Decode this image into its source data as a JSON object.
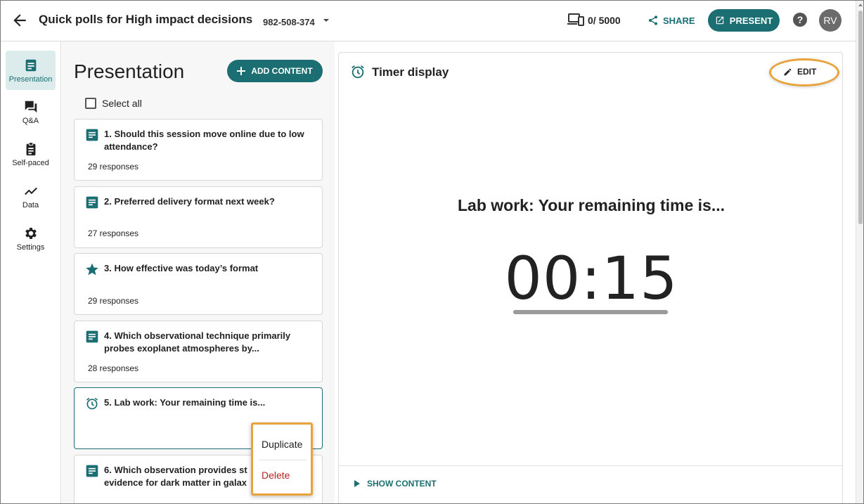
{
  "header": {
    "title": "Quick polls for High impact decisions",
    "session_code": "982-508-374",
    "participants": "0/ 5000",
    "share_label": "SHARE",
    "present_label": "PRESENT",
    "help_label": "?",
    "avatar_initials": "RV"
  },
  "sidebar": {
    "items": [
      {
        "label": "Presentation",
        "icon": "document-icon",
        "active": true
      },
      {
        "label": "Q&A",
        "icon": "chat-icon",
        "active": false
      },
      {
        "label": "Self-paced",
        "icon": "clipboard-icon",
        "active": false
      },
      {
        "label": "Data",
        "icon": "trend-icon",
        "active": false
      },
      {
        "label": "Settings",
        "icon": "gear-icon",
        "active": false
      }
    ]
  },
  "content_list": {
    "heading": "Presentation",
    "add_label": "ADD CONTENT",
    "select_all_label": "Select all",
    "items": [
      {
        "title": "1. Should this session move online due to low attendance?",
        "responses": "29 responses",
        "icon": "poll-icon"
      },
      {
        "title": "2. Preferred delivery format next week?",
        "responses": "27 responses",
        "icon": "poll-icon"
      },
      {
        "title": "3. How effective was today’s format",
        "responses": "29 responses",
        "icon": "star-icon"
      },
      {
        "title": "4. Which observational technique primarily probes exoplanet atmospheres by...",
        "responses": "28 responses",
        "icon": "poll-icon"
      },
      {
        "title": "5. Lab work: Your remaining time is...",
        "responses": "",
        "icon": "alarm-icon"
      },
      {
        "title": "6. Which observation provides st evidence for dark matter in galax",
        "responses": "",
        "icon": "poll-icon"
      }
    ]
  },
  "context_menu": {
    "duplicate_label": "Duplicate",
    "delete_label": "Delete"
  },
  "preview": {
    "title": "Timer display",
    "edit_label": "EDIT",
    "slide_title": "Lab work: Your remaining time is...",
    "timer_value": "00:15",
    "timer_progress": 1.0,
    "show_content_label": "SHOW CONTENT"
  },
  "colors": {
    "brand": "#1b6e72",
    "highlight": "#e8a33d",
    "delete": "#b3261e"
  }
}
